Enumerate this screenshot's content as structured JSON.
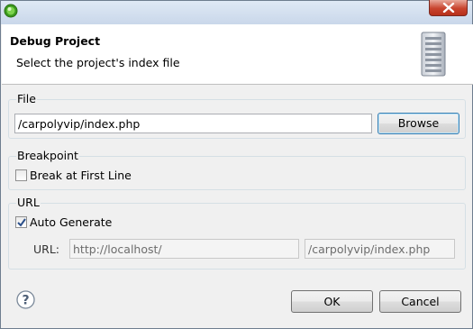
{
  "window": {
    "title": "",
    "icon": "eclipse-green-icon"
  },
  "banner": {
    "title": "Debug Project",
    "message": "Select the project's index file",
    "icon": "server-icon"
  },
  "file_group": {
    "label": "File",
    "path_value": "/carpolyvip/index.php",
    "browse_label": "Browse"
  },
  "breakpoint_group": {
    "label": "Breakpoint",
    "break_first_line_label": "Break at First Line",
    "break_first_line_checked": false
  },
  "url_group": {
    "label": "URL",
    "auto_generate_label": "Auto Generate",
    "auto_generate_checked": true,
    "url_label": "URL:",
    "base_url_value": "http://localhost/",
    "path_value": "/carpolyvip/index.php"
  },
  "footer": {
    "help_icon": "help-icon",
    "ok_label": "OK",
    "cancel_label": "Cancel"
  },
  "colors": {
    "close_button": "#c8442e",
    "default_button_border": "#3c7fb1"
  }
}
